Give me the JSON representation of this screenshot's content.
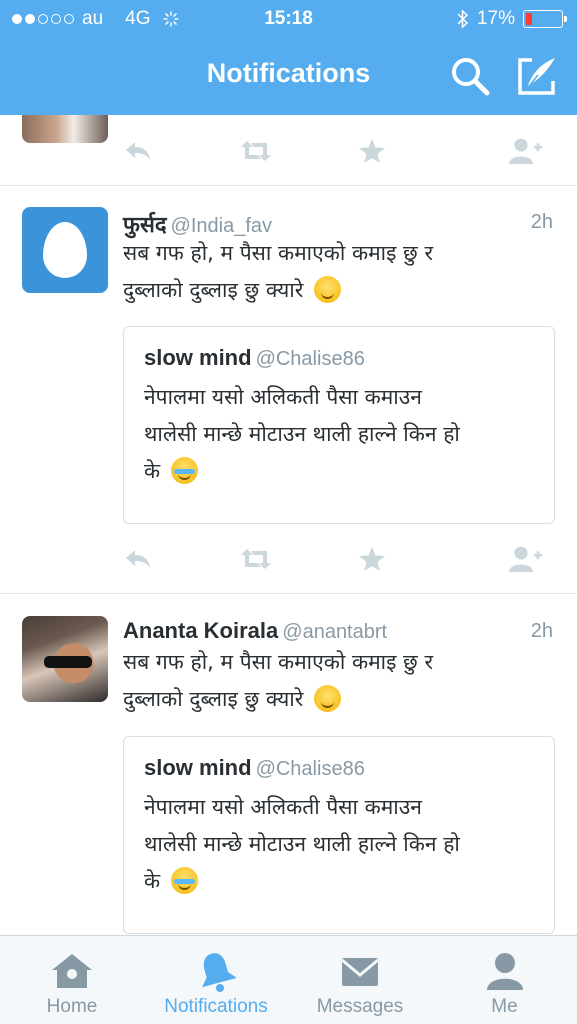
{
  "colors": {
    "brand": "#55acee",
    "battery_low": "#ff3b30",
    "muted": "#8899a6",
    "text": "#292f33"
  },
  "status_bar": {
    "carrier": "au",
    "network": "4G",
    "time": "15:18",
    "battery": "17%",
    "battery_level": 0.17
  },
  "nav": {
    "title": "Notifications",
    "search_icon": "search-icon",
    "compose_icon": "compose-icon"
  },
  "tweets": [
    {
      "name": "फुर्सद",
      "handle": "@India_fav",
      "time": "2h",
      "text_line1": "सब गफ हो, म पैसा कमाएको कमाइ छु र",
      "text_line2": "दुब्लाको दुब्लाइ छु क्यारे",
      "emoji": "yum-emoji",
      "quote": {
        "name": "slow mind",
        "handle": "@Chalise86",
        "line1": "नेपालमा यसो अलिकती पैसा कमाउन",
        "line2": "थालेसी मान्छे मोटाउन थाली हाल्ने किन हो",
        "line3": "के",
        "emoji": "tears-of-joy-emoji"
      }
    },
    {
      "name": "Ananta Koirala",
      "handle": "@anantabrt",
      "time": "2h",
      "text_line1": "सब गफ हो, म पैसा कमाएको कमाइ छु र",
      "text_line2": "दुब्लाको दुब्लाइ छु क्यारे",
      "emoji": "yum-emoji",
      "quote": {
        "name": "slow mind",
        "handle": "@Chalise86",
        "line1": "नेपालमा यसो अलिकती पैसा कमाउन",
        "line2": "थालेसी मान्छे मोटाउन थाली हाल्ने किन हो",
        "line3": "के",
        "emoji": "tears-of-joy-emoji"
      }
    }
  ],
  "tabs": [
    {
      "label": "Home",
      "icon": "home-icon",
      "active": false
    },
    {
      "label": "Notifications",
      "icon": "bell-icon",
      "active": true
    },
    {
      "label": "Messages",
      "icon": "envelope-icon",
      "active": false
    },
    {
      "label": "Me",
      "icon": "person-icon",
      "active": false
    }
  ]
}
